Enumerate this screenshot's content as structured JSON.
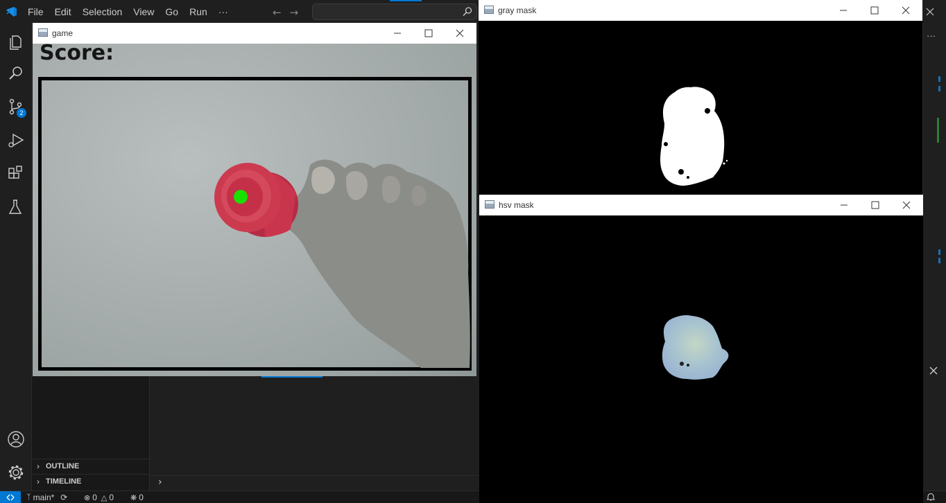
{
  "menu": [
    "File",
    "Edit",
    "Selection",
    "View",
    "Go",
    "Run",
    "···"
  ],
  "activity": {
    "items": [
      "explorer-icon",
      "search-icon",
      "source-control-icon",
      "run-debug-icon",
      "extensions-icon",
      "testing-icon",
      "accounts-icon",
      "settings-gear-icon"
    ],
    "source_control_badge": "2"
  },
  "sidebar": {
    "outline": "OUTLINE",
    "timeline": "TIMELINE"
  },
  "statusbar": {
    "branch": "main*",
    "errors": "0",
    "warnings": "0",
    "ports": "0"
  },
  "windows": {
    "game": {
      "title": "game",
      "score_label": "Score:"
    },
    "gray": {
      "title": "gray mask"
    },
    "hsv": {
      "title": "hsv mask"
    }
  },
  "colors": {
    "accent": "#0078d4",
    "target_dot": "#19e000",
    "bottle": "#c8354d"
  }
}
